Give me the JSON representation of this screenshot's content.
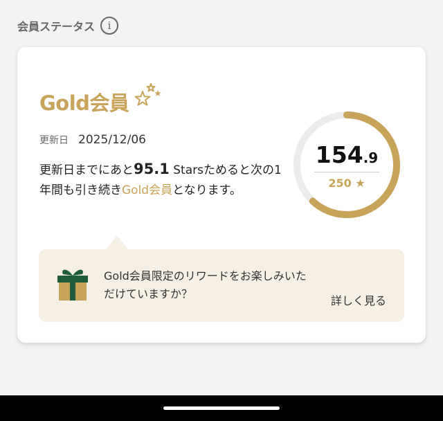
{
  "section": {
    "title": "会員ステータス",
    "info_icon": "info-circle-icon"
  },
  "card": {
    "tier_title": "Gold会員",
    "renew_label": "更新日",
    "renew_date": "2025/12/06",
    "description": {
      "part1": "更新日までにあと",
      "stars_needed": "95.1",
      "part2": " Starsためると次の1年間も引き続き",
      "tier": "Gold会員",
      "part3": "となります。"
    },
    "gauge": {
      "value_int": "154",
      "value_dec": ".9",
      "target": "250",
      "target_icon": "star-icon",
      "progress": 0.6196
    },
    "promo": {
      "icon": "gift-icon",
      "text": "Gold会員限定のリワードをお楽しみいただけていますか？",
      "link": "詳しく見る"
    }
  },
  "colors": {
    "gold": "#c8a35a",
    "gauge_track": "#ececec",
    "promo_bg": "#f6f0e4",
    "gift_green": "#1f5c3a",
    "gift_box": "#c8a35a"
  }
}
